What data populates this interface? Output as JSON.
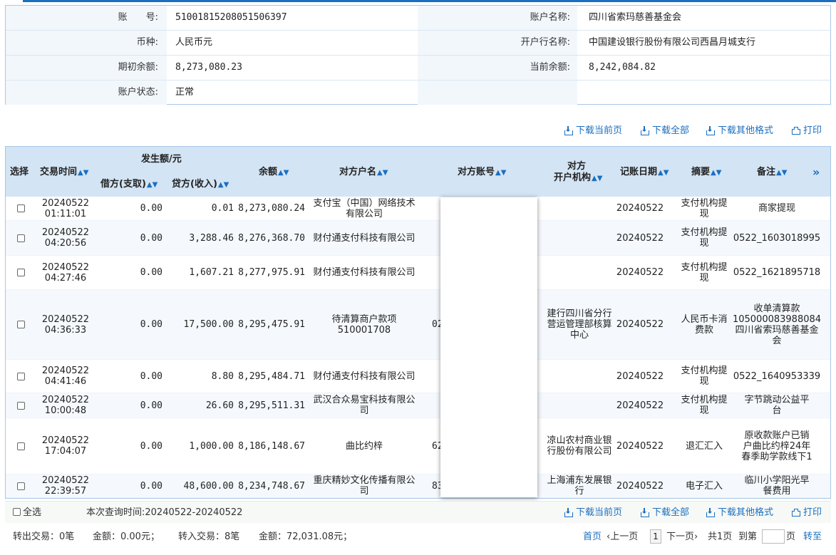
{
  "account_info": {
    "rows": [
      {
        "left_label": "账　　号:",
        "left_value": "51001815208051506397",
        "right_label": "账户名称:",
        "right_value": "四川省索玛慈善基金会"
      },
      {
        "left_label": "币种:",
        "left_value": "人民币元",
        "right_label": "开户行名称:",
        "right_value": "中国建设银行股份有限公司西昌月城支行"
      },
      {
        "left_label": "期初余额:",
        "left_value": "8,273,080.23",
        "right_label": "当前余额:",
        "right_value": "8,242,084.82"
      },
      {
        "left_label": "账户状态:",
        "left_value": "正常",
        "right_label": "",
        "right_value": ""
      }
    ]
  },
  "toolbar": {
    "download_page": "下载当前页",
    "download_all": "下载全部",
    "download_other": "下载其他格式",
    "print": "打印"
  },
  "table": {
    "headers": {
      "select": "选择",
      "time": "交易时间",
      "amount_group": "发生额/元",
      "debit": "借方(支取)",
      "credit": "贷方(收入)",
      "balance": "余额",
      "counterparty_name": "对方户名",
      "counterparty_account": "对方账号",
      "counterparty_bank_1": "对方",
      "counterparty_bank_2": "开户机构",
      "booking_date": "记账日期",
      "summary": "摘要",
      "remark": "备注",
      "more": "»"
    },
    "rows": [
      {
        "date": "20240522",
        "time": "01:11:01",
        "debit": "0.00",
        "credit": "0.01",
        "balance": "8,273,080.24",
        "name": "支付宝（中国）网络技术有限公司",
        "account": "",
        "bank": "",
        "book_date": "20240522",
        "summary": "支付机构提现",
        "remark": "商家提现"
      },
      {
        "date": "20240522",
        "time": "04:20:56",
        "debit": "0.00",
        "credit": "3,288.46",
        "balance": "8,276,368.70",
        "name": "财付通支付科技有限公司",
        "account": "",
        "bank": "",
        "book_date": "20240522",
        "summary": "支付机构提现",
        "remark": "0522_1603018995"
      },
      {
        "date": "20240522",
        "time": "04:27:46",
        "debit": "0.00",
        "credit": "1,607.21",
        "balance": "8,277,975.91",
        "name": "财付通支付科技有限公司",
        "account": "",
        "bank": "",
        "book_date": "20240522",
        "summary": "支付机构提现",
        "remark": "0522_1621895718"
      },
      {
        "date": "20240522",
        "time": "04:36:33",
        "debit": "0.00",
        "credit": "17,500.00",
        "balance": "8,295,475.91",
        "name": "待清算商户款项510001708",
        "account": "02",
        "bank": "建行四川省分行营运管理部核算中心",
        "book_date": "20240522",
        "summary": "人民币卡消费款",
        "remark": "收单清算款105000083988084四川省索玛慈善基金会"
      },
      {
        "date": "20240522",
        "time": "04:41:46",
        "debit": "0.00",
        "credit": "8.80",
        "balance": "8,295,484.71",
        "name": "财付通支付科技有限公司",
        "account": "",
        "bank": "",
        "book_date": "20240522",
        "summary": "支付机构提现",
        "remark": "0522_1640953339"
      },
      {
        "date": "20240522",
        "time": "10:00:48",
        "debit": "0.00",
        "credit": "26.60",
        "balance": "8,295,511.31",
        "name": "武汉合众易宝科技有限公司",
        "account": "",
        "bank": "",
        "book_date": "20240522",
        "summary": "支付机构提现",
        "remark": "字节跳动公益平台"
      },
      {
        "date": "20240522",
        "time": "17:04:07",
        "debit": "0.00",
        "credit": "1,000.00",
        "balance": "8,186,148.67",
        "name": "曲比约梓",
        "account": "62",
        "bank": "凉山农村商业银行股份有限公司",
        "book_date": "20240522",
        "summary": "退汇汇入",
        "remark": "原收款账户已销户曲比约梓24年春季助学款线下1"
      },
      {
        "date": "20240522",
        "time": "22:39:57",
        "debit": "0.00",
        "credit": "48,600.00",
        "balance": "8,234,748.67",
        "name": "重庆精妙文化传播有限公司",
        "account": "831",
        "bank": "上海浦东发展银行",
        "book_date": "20240522",
        "summary": "电子汇入",
        "remark": "临川小学阳光早餐费用"
      }
    ]
  },
  "footer": {
    "select_all": "全选",
    "query_period": "本次查询时间:20240522-20240522",
    "summary_line": {
      "out_label": "转出交易：0笔",
      "out_amount": "金额：0.00元；",
      "in_label": "转入交易：8笔",
      "in_amount": "金额：72,031.08元；"
    },
    "pagination": {
      "first": "首页",
      "prev": "‹上一页",
      "current": "1",
      "next": "下一页›",
      "total": "共1页",
      "goto_label": "到第",
      "page_unit": "页",
      "go": "转至"
    }
  }
}
